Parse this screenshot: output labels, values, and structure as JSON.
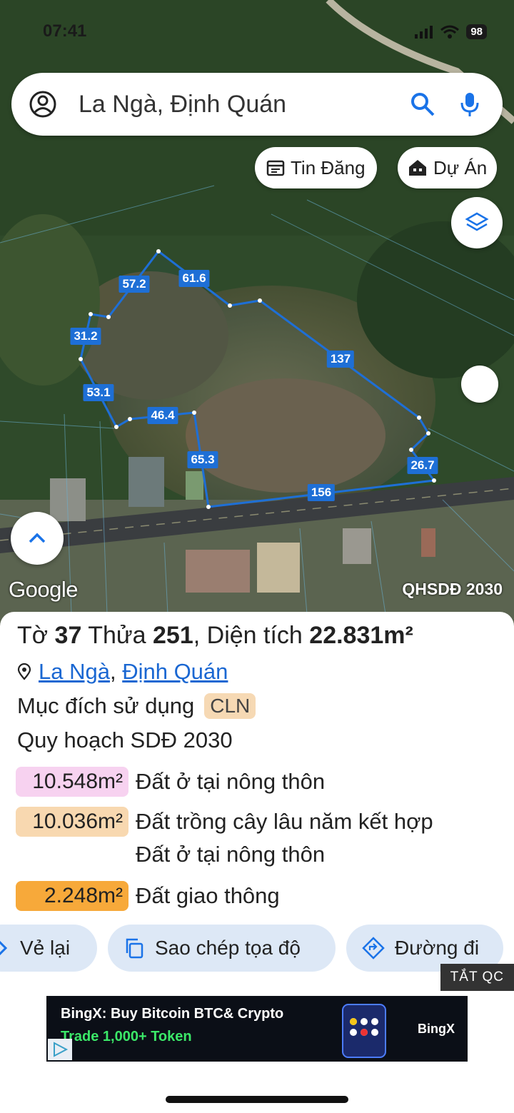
{
  "status_bar": {
    "time": "07:41",
    "battery": "98"
  },
  "search": {
    "query": "La Ngà, Định Quán"
  },
  "chips": {
    "listings": "Tin Đăng",
    "projects": "Dự Án"
  },
  "map": {
    "measurements": [
      "57.2",
      "61.6",
      "31.2",
      "137",
      "53.1",
      "46.4",
      "65.3",
      "26.7",
      "156"
    ],
    "attribution": "Google",
    "layer_label": "QHSDĐ 2030",
    "parcel_color": "#1e6fd6"
  },
  "parcel": {
    "sheet_label": "Tờ",
    "sheet_no": "37",
    "plot_label": "Thửa",
    "plot_no": "251",
    "area_label": "Diện tích",
    "area_value": "22.831m²",
    "commune": "La Ngà",
    "district": "Định Quán",
    "purpose_label": "Mục đích sử dụng",
    "purpose_code": "CLN",
    "plan_label": "Quy hoạch SDĐ 2030"
  },
  "zones": [
    {
      "area": "10.548m²",
      "line1": "Đất ở tại nông thôn",
      "line2": "",
      "color": "#f7d2f0"
    },
    {
      "area": "10.036m²",
      "line1": "Đất trồng cây lâu năm kết hợp",
      "line2": "Đất ở tại nông thôn",
      "color": "#f8d8b0"
    },
    {
      "area": "2.248m²",
      "line1": "Đất giao thông",
      "line2": "",
      "color": "#f7a93a"
    }
  ],
  "actions": {
    "redraw": "Vẻ lại",
    "copy": "Sao chép tọa độ",
    "directions": "Đường đi"
  },
  "ad": {
    "close_label": "TẮT QC",
    "line1": "BingX: Buy Bitcoin BTC& Crypto",
    "line2": "Trade 1,000+ Token",
    "brand": "BingX"
  }
}
